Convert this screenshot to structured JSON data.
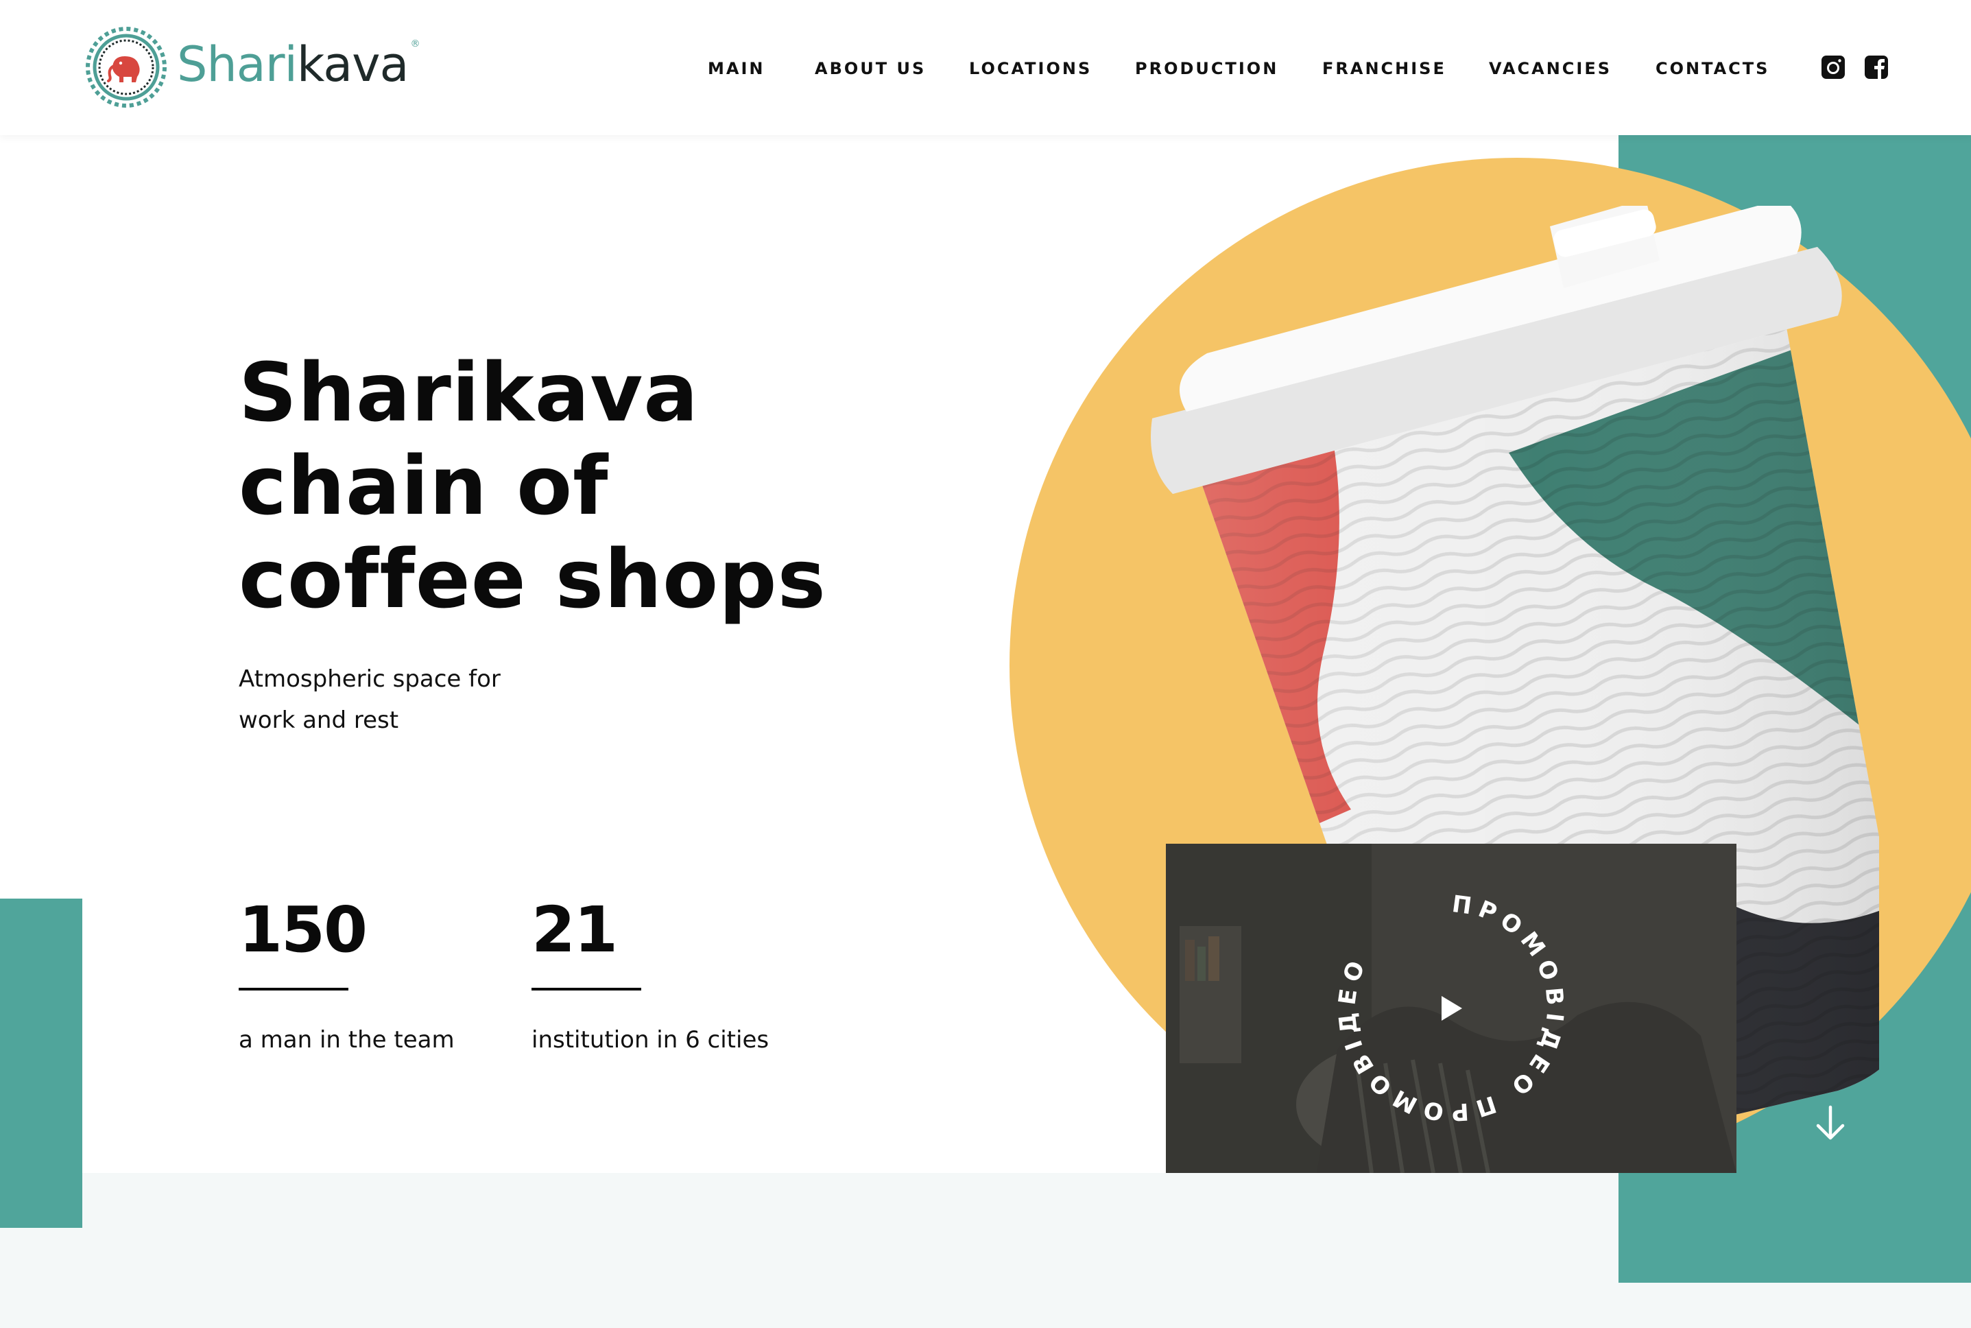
{
  "brand": {
    "name_part_a": "Shari",
    "name_part_b": "kava",
    "registered_mark": "®",
    "colors": {
      "teal": "#50a59b",
      "yellow": "#f5c466",
      "red": "#d8473f",
      "dark": "#2f3235"
    }
  },
  "nav": {
    "items": [
      {
        "id": "main",
        "label": "MAIN"
      },
      {
        "id": "about",
        "label": "ABOUT US"
      },
      {
        "id": "locations",
        "label": "LOCATIONS"
      },
      {
        "id": "production",
        "label": "PRODUCTION"
      },
      {
        "id": "franchise",
        "label": "FRANCHISE"
      },
      {
        "id": "vacancies",
        "label": "VACANCIES"
      },
      {
        "id": "contacts",
        "label": "CONTACTS"
      }
    ],
    "social": [
      "instagram-icon",
      "facebook-icon"
    ]
  },
  "hero": {
    "title_lines": [
      "Sharikava",
      "chain of",
      "coffee shops"
    ],
    "subtitle_lines": [
      "Atmospheric space for",
      "work and rest"
    ],
    "stats": [
      {
        "value": "150",
        "label": "a man in the team"
      },
      {
        "value": "21",
        "label": "institution in 6 cities"
      }
    ]
  },
  "video": {
    "badge_text": "ПРОМОВІДЕО ПРОМОВІДЕО ",
    "icon": "play-icon"
  },
  "scroll": {
    "icon": "arrow-down-icon"
  }
}
